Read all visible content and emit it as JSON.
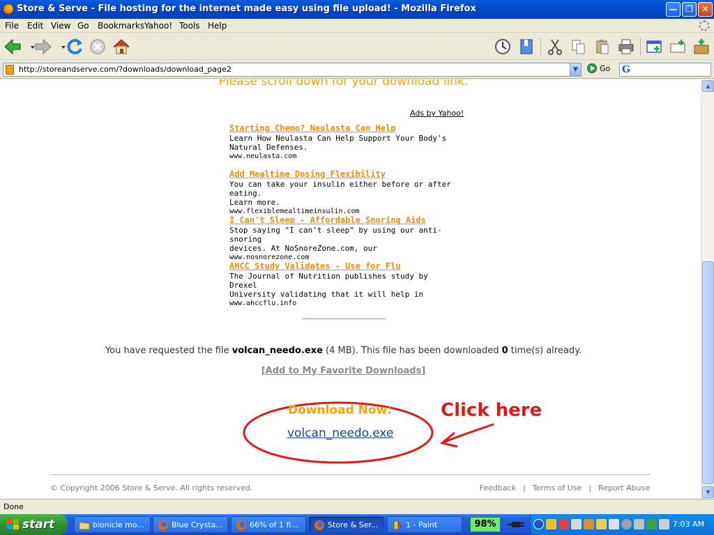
{
  "window": {
    "title": "Store & Serve - File hosting for the internet made easy using file upload! - Mozilla Firefox"
  },
  "menu": [
    "File",
    "Edit",
    "View",
    "Go",
    "Bookmarks",
    "Yahoo!",
    "Tools",
    "Help"
  ],
  "address": {
    "url": "http://storeandserve.com/?downloads/download_page2",
    "go_label": "Go"
  },
  "page": {
    "scroll_note": "Please scroll down for your download link.",
    "ads_by": "Ads by Yahoo!",
    "ads": [
      {
        "title": "Starting Chemo? Neulasta Can Help",
        "line1": "Learn How Neulasta Can Help Support Your Body's",
        "line2": "Natural Defenses.",
        "domain": "www.neulasta.com"
      },
      {
        "title": "Add Mealtime Dosing Flexibility",
        "line1": "You can take your insulin either before or after eating.",
        "line2": "Learn more.",
        "domain": "www.flexiblemealtimeinsulin.com"
      },
      {
        "title": "I Can't Sleep - Affordable Snoring Aids",
        "line1": "Stop saying \"I can't sleep\" by using our anti-snoring",
        "line2": "devices. At NoSnoreZone.com, our",
        "domain": "www.nosnorezone.com"
      },
      {
        "title": "AHCC Study Validates - Use for Flu",
        "line1": "The Journal of Nutrition publishes study by Drexel",
        "line2": "University validating that it will help in",
        "domain": "www.ahccflu.info"
      }
    ],
    "request": {
      "prefix": "You have requested the file",
      "filename": "volcan_needo.exe",
      "size": "(4 MB)",
      "middle": ". This file has been downloaded",
      "count": "0",
      "suffix": "time(s) already."
    },
    "favorite_link": "[Add to My Favorite Downloads]",
    "download_now": "Download Now:",
    "download_link": "volcan_needo.exe",
    "annotation": "Click here",
    "copyright": "© Copyright 2006 Store & Serve. All rights reserved.",
    "footer_links": [
      "Feedback",
      "Terms of Use",
      "Report Abuse"
    ],
    "footer_sep": "|"
  },
  "status": "Done",
  "taskbar": {
    "start": "start",
    "items": [
      {
        "label": "bionicle mo...",
        "icon": "folder-icon"
      },
      {
        "label": "Blue Crysta...",
        "icon": "firefox-icon"
      },
      {
        "label": "66% of 1 fi...",
        "icon": "firefox-icon"
      },
      {
        "label": "Store & Ser...",
        "icon": "firefox-icon",
        "active": true
      },
      {
        "label": "1 - Paint",
        "icon": "paint-icon"
      }
    ],
    "battery": "98%",
    "clock": "7:03 AM"
  },
  "colors": {
    "accent_orange": "#F5A300",
    "link_blue": "#1A3FA0",
    "annotation_red": "#E01818",
    "xp_blue": "#0054E3"
  }
}
